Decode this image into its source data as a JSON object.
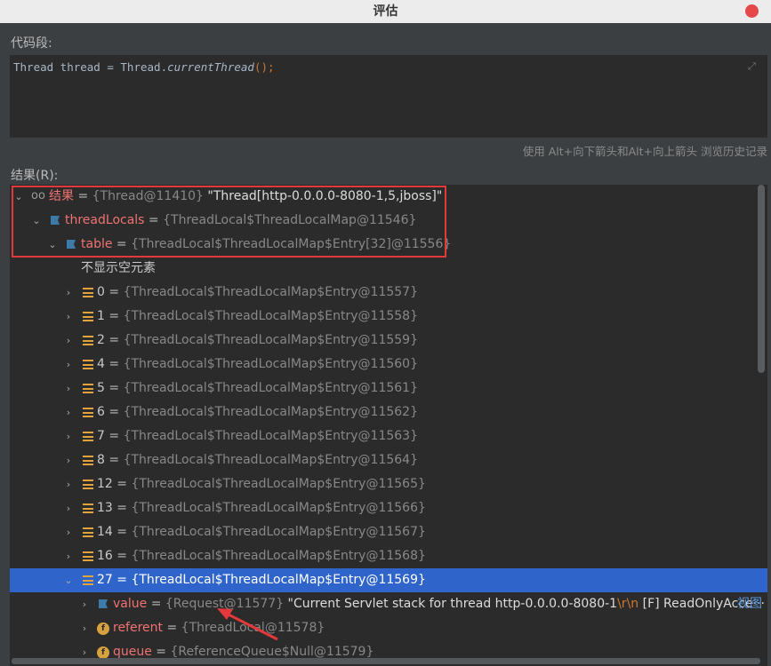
{
  "window": {
    "title": "评估"
  },
  "code_section": {
    "label": "代码段:",
    "code": {
      "part1": "Thread thread = Thread.",
      "part2": "currentThread",
      "part3": "();"
    },
    "hint": "使用 Alt+向下箭头和Alt+向上箭头 浏览历史记录"
  },
  "result_section": {
    "label": "结果(R):",
    "root": {
      "name": "结果",
      "eq": " = ",
      "ref": "{Thread@11410}",
      "value": " \"Thread[http-0.0.0.0-8080-1,5,jboss]\""
    },
    "threadLocals": {
      "name": "threadLocals",
      "eq": " = ",
      "ref": "{ThreadLocal$ThreadLocalMap@11546}"
    },
    "table": {
      "name": "table",
      "eq": " = ",
      "ref": "{ThreadLocal$ThreadLocalMap$Entry[32]@11556}"
    },
    "empty_note": "不显示空元素",
    "entries": [
      {
        "index": "0",
        "eq": " = ",
        "ref": "{ThreadLocal$ThreadLocalMap$Entry@11557}"
      },
      {
        "index": "1",
        "eq": " = ",
        "ref": "{ThreadLocal$ThreadLocalMap$Entry@11558}"
      },
      {
        "index": "2",
        "eq": " = ",
        "ref": "{ThreadLocal$ThreadLocalMap$Entry@11559}"
      },
      {
        "index": "4",
        "eq": " = ",
        "ref": "{ThreadLocal$ThreadLocalMap$Entry@11560}"
      },
      {
        "index": "5",
        "eq": " = ",
        "ref": "{ThreadLocal$ThreadLocalMap$Entry@11561}"
      },
      {
        "index": "6",
        "eq": " = ",
        "ref": "{ThreadLocal$ThreadLocalMap$Entry@11562}"
      },
      {
        "index": "7",
        "eq": " = ",
        "ref": "{ThreadLocal$ThreadLocalMap$Entry@11563}"
      },
      {
        "index": "8",
        "eq": " = ",
        "ref": "{ThreadLocal$ThreadLocalMap$Entry@11564}"
      },
      {
        "index": "12",
        "eq": " = ",
        "ref": "{ThreadLocal$ThreadLocalMap$Entry@11565}"
      },
      {
        "index": "13",
        "eq": " = ",
        "ref": "{ThreadLocal$ThreadLocalMap$Entry@11566}"
      },
      {
        "index": "14",
        "eq": " = ",
        "ref": "{ThreadLocal$ThreadLocalMap$Entry@11567}"
      },
      {
        "index": "16",
        "eq": " = ",
        "ref": "{ThreadLocal$ThreadLocalMap$Entry@11568}"
      },
      {
        "index": "27",
        "eq": " = ",
        "ref": "{ThreadLocal$ThreadLocalMap$Entry@11569}"
      }
    ],
    "value_row": {
      "name": "value",
      "eq": " = ",
      "ref": "{Request@11577}",
      "str_start": " \"Current Servlet stack for thread http-0.0.0.0-8080-1",
      "esc": "\\r\\n",
      "str_rest": "  [F] ReadOnlyAcce···",
      "view_link": "视图"
    },
    "referent_row": {
      "name": "referent",
      "eq": " = ",
      "ref": "{ThreadLocal@11578}"
    },
    "queue_row": {
      "name": "queue",
      "eq": " = ",
      "ref": "{ReferenceQueue$Null@11579}"
    }
  },
  "colors": {
    "background": "#3c3f41",
    "editor": "#2b2b2b",
    "selection": "#2f65ca",
    "highlight": "#e3393c",
    "field_name": "#f07272"
  }
}
